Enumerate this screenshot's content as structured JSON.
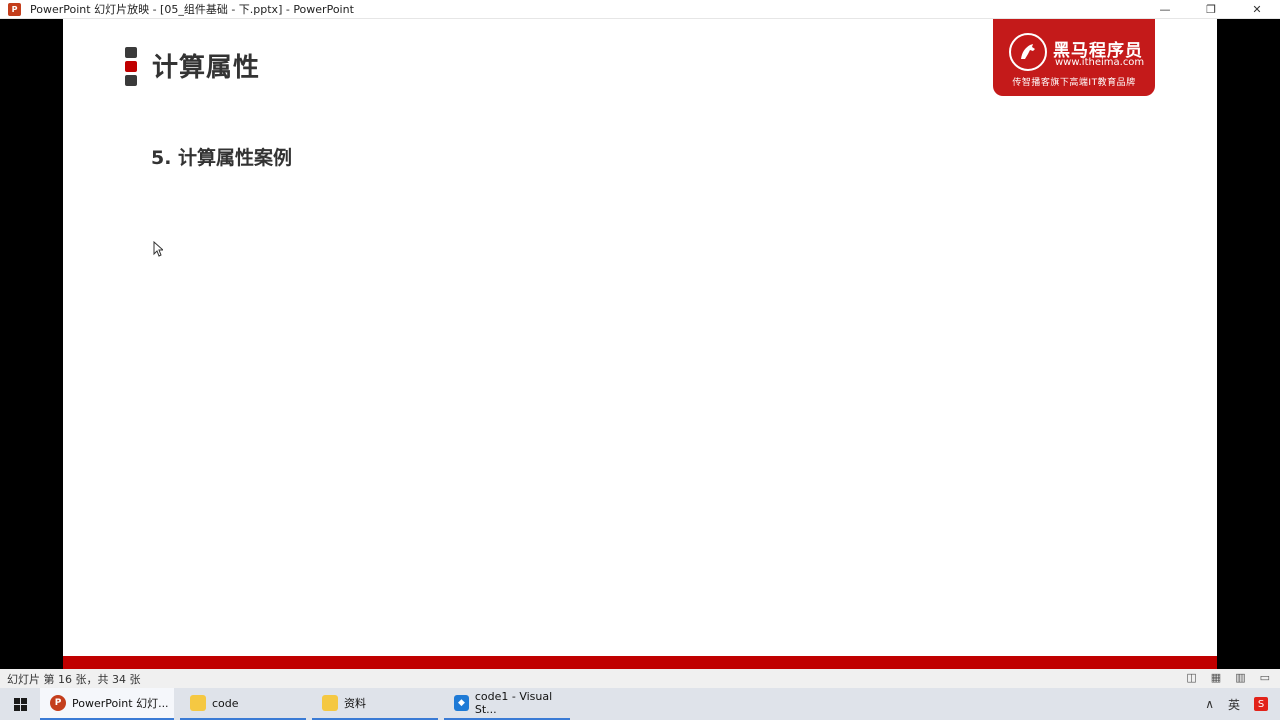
{
  "window": {
    "app_icon_letter": "P",
    "title": "PowerPoint 幻灯片放映 - [05_组件基础 - 下.pptx] - PowerPoint",
    "minimize_glyph": "—",
    "restore_glyph": "❐",
    "close_glyph": "✕"
  },
  "slide": {
    "title": "计算属性",
    "subtitle": "5. 计算属性案例",
    "logo": {
      "name": "黑马程序员",
      "url": "www.itheima.com",
      "slogan": "传智播客旗下高端IT教育品牌"
    },
    "accent_color": "#c00000"
  },
  "statusbar": {
    "text": "幻灯片 第 16 张，共 34 张"
  },
  "taskbar": {
    "items": [
      {
        "label": "PowerPoint 幻灯...",
        "icon": "powerpoint-icon"
      },
      {
        "label": "code",
        "icon": "folder-icon"
      },
      {
        "label": "资料",
        "icon": "folder-icon"
      },
      {
        "label": "code1 - Visual St...",
        "icon": "vscode-icon"
      }
    ],
    "tray": {
      "chevron": "∧",
      "ime": "英",
      "sogou": "S"
    }
  }
}
